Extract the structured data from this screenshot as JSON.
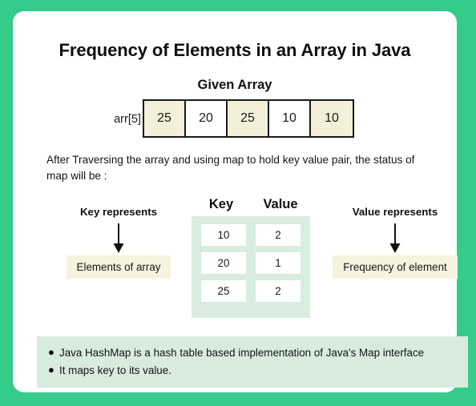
{
  "title": "Frequency of Elements in an Array in Java",
  "given_array": {
    "heading": "Given Array",
    "arr_label": "arr[5] :",
    "cells": [
      {
        "value": "25",
        "highlighted": true
      },
      {
        "value": "20",
        "highlighted": false
      },
      {
        "value": "25",
        "highlighted": true
      },
      {
        "value": "10",
        "highlighted": false
      },
      {
        "value": "10",
        "highlighted": true
      }
    ]
  },
  "paragraph": "After Traversing the array and using map to hold key value pair, the status of map will be :",
  "left_annotation": {
    "caption": "Key represents",
    "box_label": "Elements of array"
  },
  "right_annotation": {
    "caption": "Value represents",
    "box_label": "Frequency of element"
  },
  "map_table": {
    "headers": [
      "Key",
      "Value"
    ],
    "rows": [
      {
        "key": "10",
        "value": "2"
      },
      {
        "key": "20",
        "value": "1"
      },
      {
        "key": "25",
        "value": "2"
      }
    ]
  },
  "notes": {
    "bullet_glyph": "●",
    "items": [
      "Java HashMap is a hash table based implementation of Java's Map interface",
      "It maps key to its value."
    ]
  },
  "colors": {
    "page_background": "#35cb8a",
    "card_background": "#ffffff",
    "array_highlight": "#f2f0d8",
    "yellow_box": "#f5f3de",
    "table_background": "#d8ece0",
    "notes_background": "#d8ecdd",
    "text": "#141414"
  }
}
